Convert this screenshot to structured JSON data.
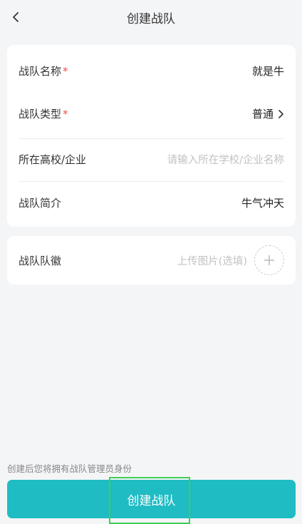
{
  "header": {
    "title": "创建战队",
    "back_icon": "chevron-left-icon"
  },
  "form": {
    "team_name": {
      "label": "战队名称",
      "required_mark": "*",
      "value": "就是牛"
    },
    "team_type": {
      "label": "战队类型",
      "required_mark": "*",
      "value": "普通",
      "icon": "chevron-right-icon"
    },
    "school": {
      "label": "所在高校/企业",
      "placeholder": "请输入所在学校/企业名称"
    },
    "intro": {
      "label": "战队简介",
      "value": "牛气冲天"
    },
    "badge": {
      "label": "战队队徽",
      "placeholder": "上传图片(选填)",
      "icon": "plus-icon"
    }
  },
  "footer": {
    "note": "创建后您将拥有战队管理员身份",
    "create_button": "创建战队"
  },
  "colors": {
    "accent": "#1fbcc4",
    "required": "#f04b4b",
    "background": "#f4f5f7",
    "highlight": "#3fcf55"
  }
}
